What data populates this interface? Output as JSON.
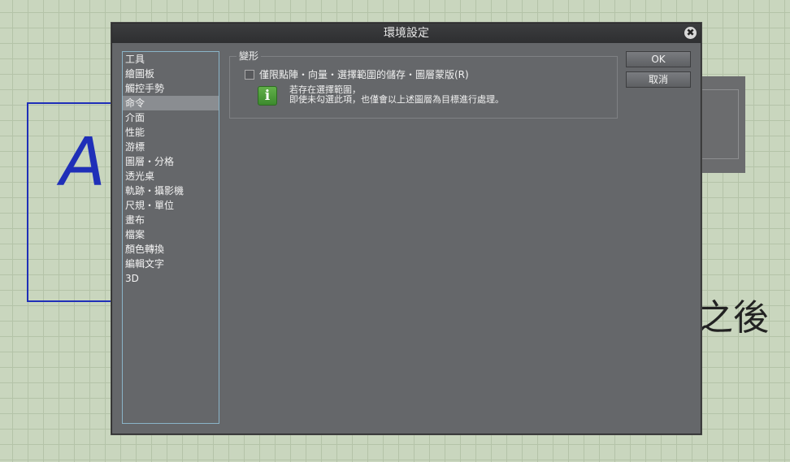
{
  "background": {
    "canvas_letter": "A",
    "canvas_text": "之後"
  },
  "dialog": {
    "title": "環境設定",
    "close_glyph": "✖",
    "sidebar": {
      "items": [
        {
          "label": "工具"
        },
        {
          "label": "繪圖板"
        },
        {
          "label": "觸控手勢"
        },
        {
          "label": "命令",
          "selected": true
        },
        {
          "label": "介面"
        },
        {
          "label": "性能"
        },
        {
          "label": "游標"
        },
        {
          "label": "圖層・分格"
        },
        {
          "label": "透光桌"
        },
        {
          "label": "軌跡・攝影機"
        },
        {
          "label": "尺規・單位"
        },
        {
          "label": "畫布"
        },
        {
          "label": "檔案"
        },
        {
          "label": "顏色轉換"
        },
        {
          "label": "編輯文字"
        },
        {
          "label": "3D"
        }
      ]
    },
    "section": {
      "legend": "變形",
      "checkbox_label": "僅限點陣・向量・選擇範圍的儲存・圖層蒙版(R)",
      "checkbox_checked": false,
      "info_icon": "i",
      "info_line1": "若存在選擇範圍，",
      "info_line2": "即使未勾選此項，也僅會以上述圖層為目標進行處理。"
    },
    "buttons": {
      "ok": "OK",
      "cancel": "取消"
    }
  }
}
